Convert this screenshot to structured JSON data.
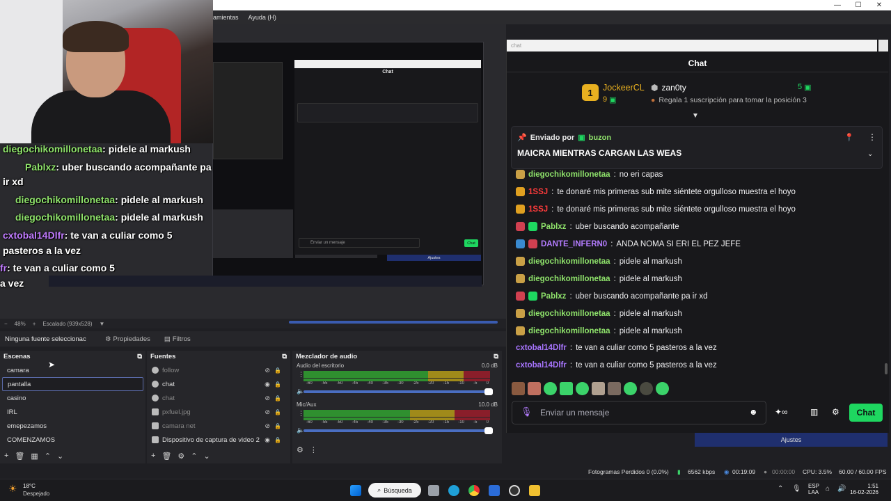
{
  "window": {
    "menu": [
      "rramientas",
      "Ayuda (H)"
    ],
    "controls": [
      "—",
      "☐",
      "✕"
    ]
  },
  "preview": {
    "zoom": "48%",
    "scale": "Escalado (939x528)",
    "overlay_chat": [
      {
        "user": "diegochikomillonetaa",
        "text": ": pidele al markush"
      },
      {
        "user": "Pablxz",
        "text": ": uber buscando acompañante pa"
      },
      {
        "user": "",
        "text": "ir xd"
      },
      {
        "user": "diegochikomillonetaa",
        "text": ": pidele al markush"
      },
      {
        "user": "diegochikomillonetaa",
        "text": ": pidele al markush"
      },
      {
        "user": "cxtobal14Dlfr",
        "text": ": te van a culiar como 5"
      },
      {
        "user": "",
        "text": "pasteros a la vez"
      },
      {
        "user": "fr",
        "text": ": te van a culiar como 5"
      },
      {
        "user": "",
        "text": "a vez"
      }
    ],
    "mini_chat_title": "Chat",
    "mini_input": "Enviar un mensaje",
    "mini_send": "Chat",
    "mini_ajustes": "Ajustes"
  },
  "properties_bar": {
    "no_source": "Ninguna fuente seleccionac",
    "properties": "Propiedades",
    "filters": "Filtros"
  },
  "scenes": {
    "title": "Escenas",
    "items": [
      "camara",
      "pantalla",
      "casino",
      "IRL",
      "emepezamos",
      "COMENZAMOS"
    ],
    "selected": "pantalla"
  },
  "sources": {
    "title": "Fuentes",
    "items": [
      {
        "label": "follow",
        "visible": false
      },
      {
        "label": "chat",
        "visible": true
      },
      {
        "label": "chat",
        "visible": false
      },
      {
        "label": "pxfuel.jpg",
        "visible": false
      },
      {
        "label": "camara net",
        "visible": false
      },
      {
        "label": "Dispositivo de captura de video 2",
        "visible": true
      }
    ]
  },
  "mixer": {
    "title": "Mezclador de audio",
    "channels": [
      {
        "name": "Audio del escritorio",
        "db": "0.0 dB"
      },
      {
        "name": "Mic/Aux",
        "db": "10.0 dB"
      }
    ],
    "ticks": [
      "-60",
      "-55",
      "-50",
      "-45",
      "-40",
      "-35",
      "-30",
      "-25",
      "-20",
      "-15",
      "-10",
      "-5",
      "0"
    ]
  },
  "chat": {
    "url": "chat",
    "title": "Chat",
    "leader": {
      "rank": "1",
      "name": "JockeerCL",
      "count": "9"
    },
    "second": {
      "name": "zan0ty",
      "count": "5",
      "hint": "Regala 1 suscripción para tomar la posición 3"
    },
    "pinned": {
      "by_label": "Enviado por",
      "by_user": "buzon",
      "text": "MAICRA MIENTRAS CARGAN LAS WEAS"
    },
    "messages": [
      {
        "user": "diegochikomillonetaa",
        "text": "no eri capas",
        "color": "green",
        "badge": "#c9a046"
      },
      {
        "user": "1SSJ",
        "text": "te donaré mis primeras sub mite siéntete orgulloso muestra el hoyo",
        "color": "red",
        "badge": "#e0a020"
      },
      {
        "user": "1SSJ",
        "text": "te donaré mis primeras sub mite siéntete orgulloso muestra el hoyo",
        "color": "red",
        "badge": "#e0a020"
      },
      {
        "user": "Pablxz",
        "text": "uber buscando acompañante",
        "color": "green",
        "badge": "#d04050"
      },
      {
        "user": "DANTE_INFERN0",
        "text": "ANDA NOMA SI ERI EL PEZ JEFE",
        "color": "purple",
        "badge": "#3a8ad0"
      },
      {
        "user": "diegochikomillonetaa",
        "text": "pidele al markush",
        "color": "green",
        "badge": "#c9a046"
      },
      {
        "user": "diegochikomillonetaa",
        "text": "pidele al markush",
        "color": "green",
        "badge": "#c9a046"
      },
      {
        "user": "Pablxz",
        "text": "uber buscando acompañante pa ir xd",
        "color": "green",
        "badge": "#d04050"
      },
      {
        "user": "diegochikomillonetaa",
        "text": "pidele al markush",
        "color": "green",
        "badge": "#c9a046"
      },
      {
        "user": "diegochikomillonetaa",
        "text": "pidele al markush",
        "color": "green",
        "badge": "#c9a046"
      },
      {
        "user": "cxtobal14Dlfr",
        "text": "te van a culiar como 5 pasteros a la vez",
        "color": "violet",
        "badge": ""
      },
      {
        "user": "cxtobal14Dlfr",
        "text": "te van a culiar como 5 pasteros a la vez",
        "color": "violet",
        "badge": ""
      }
    ],
    "input_placeholder": "Enviar un mensaje",
    "send_label": "Chat",
    "settings_label": "Ajustes"
  },
  "status": {
    "frames_dropped": "Fotogramas Perdidos 0 (0.0%)",
    "bitrate": "6562 kbps",
    "live_time": "00:19:09",
    "rec_time": "00:00:00",
    "cpu": "CPU: 3.5%",
    "fps": "60.00 / 60.00 FPS"
  },
  "taskbar": {
    "weather_temp": "18°C",
    "weather_desc": "Despejado",
    "search": "Búsqueda",
    "lang": "ESP",
    "lang2": "LAA",
    "time": "1:51",
    "date": "16-02-2026"
  },
  "colors": {
    "accent": "#1ed760",
    "selection": "#5a6aa8",
    "ajustes": "#1f2f6e"
  }
}
